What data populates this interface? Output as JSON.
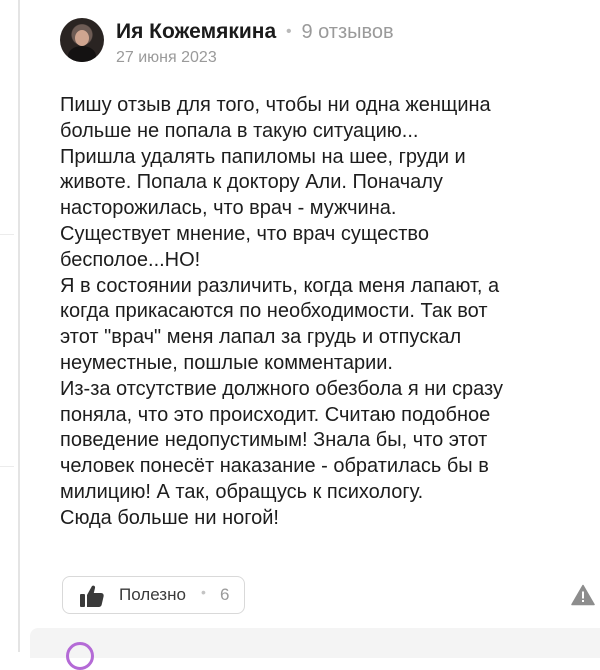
{
  "review": {
    "author": "Ия Кожемякина",
    "reviews_count": "9 отзывов",
    "date": "27 июня 2023",
    "text_lines": [
      "Пишу отзыв для того, чтобы ни одна женщина",
      "больше не попала в такую ситуацию...",
      "Пришла удалять папиломы на шее, груди и",
      "животе. Попала к доктору Али. Поначалу",
      "насторожилась, что врач - мужчина.",
      "Существует мнение, что врач существо",
      "бесполое...НО!",
      "Я в состоянии различить, когда меня лапают, а",
      "когда прикасаются по необходимости. Так вот",
      "этот \"врач\" меня лапал за грудь и отпускал",
      "неуместные, пошлые комментарии.",
      "Из-за отсутствие должного обезбола я ни сразу",
      "поняла, что это происходит. Считаю подобное",
      "поведение недопустимым! Знала бы, что этот",
      "человек понесёт наказание - обратилась бы в",
      "милицию! А так, обращусь к психологу.",
      "Сюда больше ни ногой!"
    ],
    "helpful": {
      "label": "Полезно",
      "count": "6"
    }
  },
  "colors": {
    "accent_story_ring": "#b46ad6",
    "muted_text": "#9a9a9a",
    "border": "#d9d9d9"
  },
  "icons": {
    "helpful": "thumbs-up-icon",
    "report": "warning-triangle-icon"
  }
}
